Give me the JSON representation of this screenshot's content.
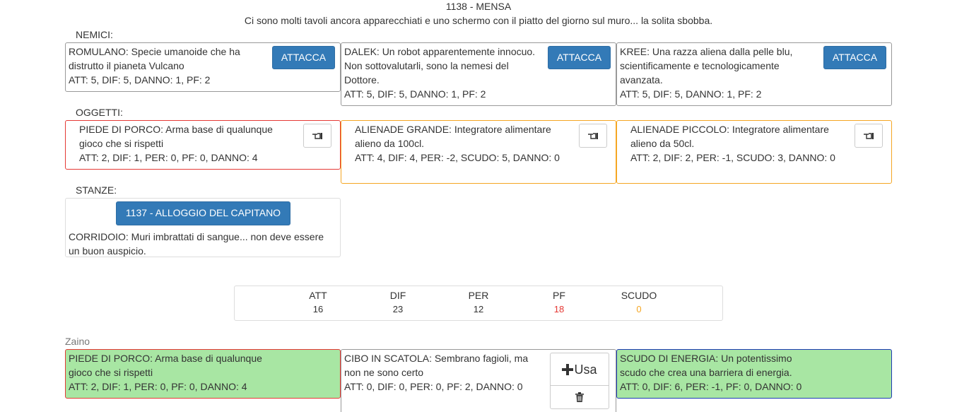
{
  "room": {
    "title": "1138 - MENSA",
    "description": "Ci sono molti tavoli ancora apparecchiati e uno schermo con il piatto del giorno sul muro... la solita sbobba."
  },
  "enemies": {
    "label": "NEMICI:",
    "attack_label": "ATTACCA",
    "items": [
      {
        "desc": "ROMULANO: Specie umanoide che ha distrutto il pianeta Vulcano",
        "stats": "ATT: 5, DIF: 5, DANNO: 1, PF: 2"
      },
      {
        "desc": "DALEK: Un robot apparentemente innocuo. Non sottovalutarli, sono la nemesi del Dottore.",
        "stats": "ATT: 5, DIF: 5, DANNO: 1, PF: 2"
      },
      {
        "desc": "KREE: Una razza aliena dalla pelle blu, scientificamente e tecnologicamente avanzata.",
        "stats": "ATT: 5, DIF: 5, DANNO: 1, PF: 2"
      }
    ]
  },
  "objects": {
    "label": "OGGETTI:",
    "items": [
      {
        "desc": "PIEDE DI PORCO: Arma base di qualunque gioco che si rispetti",
        "stats": "ATT: 2, DIF: 1, PER: 0, PF: 0, DANNO: 4",
        "border_color": "#e53935"
      },
      {
        "desc": "ALIENADE GRANDE: Integratore alimentare alieno da 100cl.",
        "stats": "ATT: 4, DIF: 4, PER: -2, SCUDO: 5, DANNO: 0",
        "border_color": "#f5a623"
      },
      {
        "desc": "ALIENADE PICCOLO: Integratore alimentare alieno da 50cl.",
        "stats": "ATT: 2, DIF: 2, PER: -1, SCUDO: 3, DANNO: 0",
        "border_color": "#f5a623"
      }
    ],
    "pickup_icon": "hand-pointer-icon"
  },
  "rooms": {
    "label": "STANZE:",
    "items": [
      {
        "button_label": "1137 - ALLOGGIO DEL CAPITANO",
        "desc": "CORRIDOIO: Muri imbrattati di sangue... non deve essere un buon auspicio."
      }
    ]
  },
  "stats": [
    {
      "label": "ATT",
      "value": "16",
      "color": "#333333"
    },
    {
      "label": "DIF",
      "value": "23",
      "color": "#333333"
    },
    {
      "label": "PER",
      "value": "12",
      "color": "#333333"
    },
    {
      "label": "PF",
      "value": "18",
      "color": "#e53935"
    },
    {
      "label": "SCUDO",
      "value": "0",
      "color": "#f5a623"
    }
  ],
  "backpack": {
    "label": "Zaino",
    "use_label": "Usa",
    "use_icon": "plus-icon",
    "trash_icon": "trash-icon",
    "items": [
      {
        "desc": "PIEDE DI PORCO: Arma base di qualunque gioco che si rispetti",
        "stats": "ATT: 2, DIF: 1, PER: 0, PF: 0, DANNO: 4",
        "equipped": true,
        "border_color": "#e53935"
      },
      {
        "desc": "CIBO IN SCATOLA: Sembrano fagioli, ma non ne sono certo",
        "stats": "ATT: 0, DIF: 0, PER: 0, PF: 2, DANNO: 0",
        "equipped": false,
        "border_color": "#999999"
      },
      {
        "desc": "SCUDO DI ENERGIA: Un potentissimo scudo che crea una barriera di energia.",
        "stats": "ATT: 0, DIF: 6, PER: -1, PF: 0, DANNO: 0",
        "equipped": true,
        "border_color": "#1e3cb4"
      }
    ]
  },
  "colors": {
    "primary": "#337ab7",
    "equipped_bg": "#a8e6a3",
    "pf": "#e53935",
    "scudo": "#f5a623"
  }
}
